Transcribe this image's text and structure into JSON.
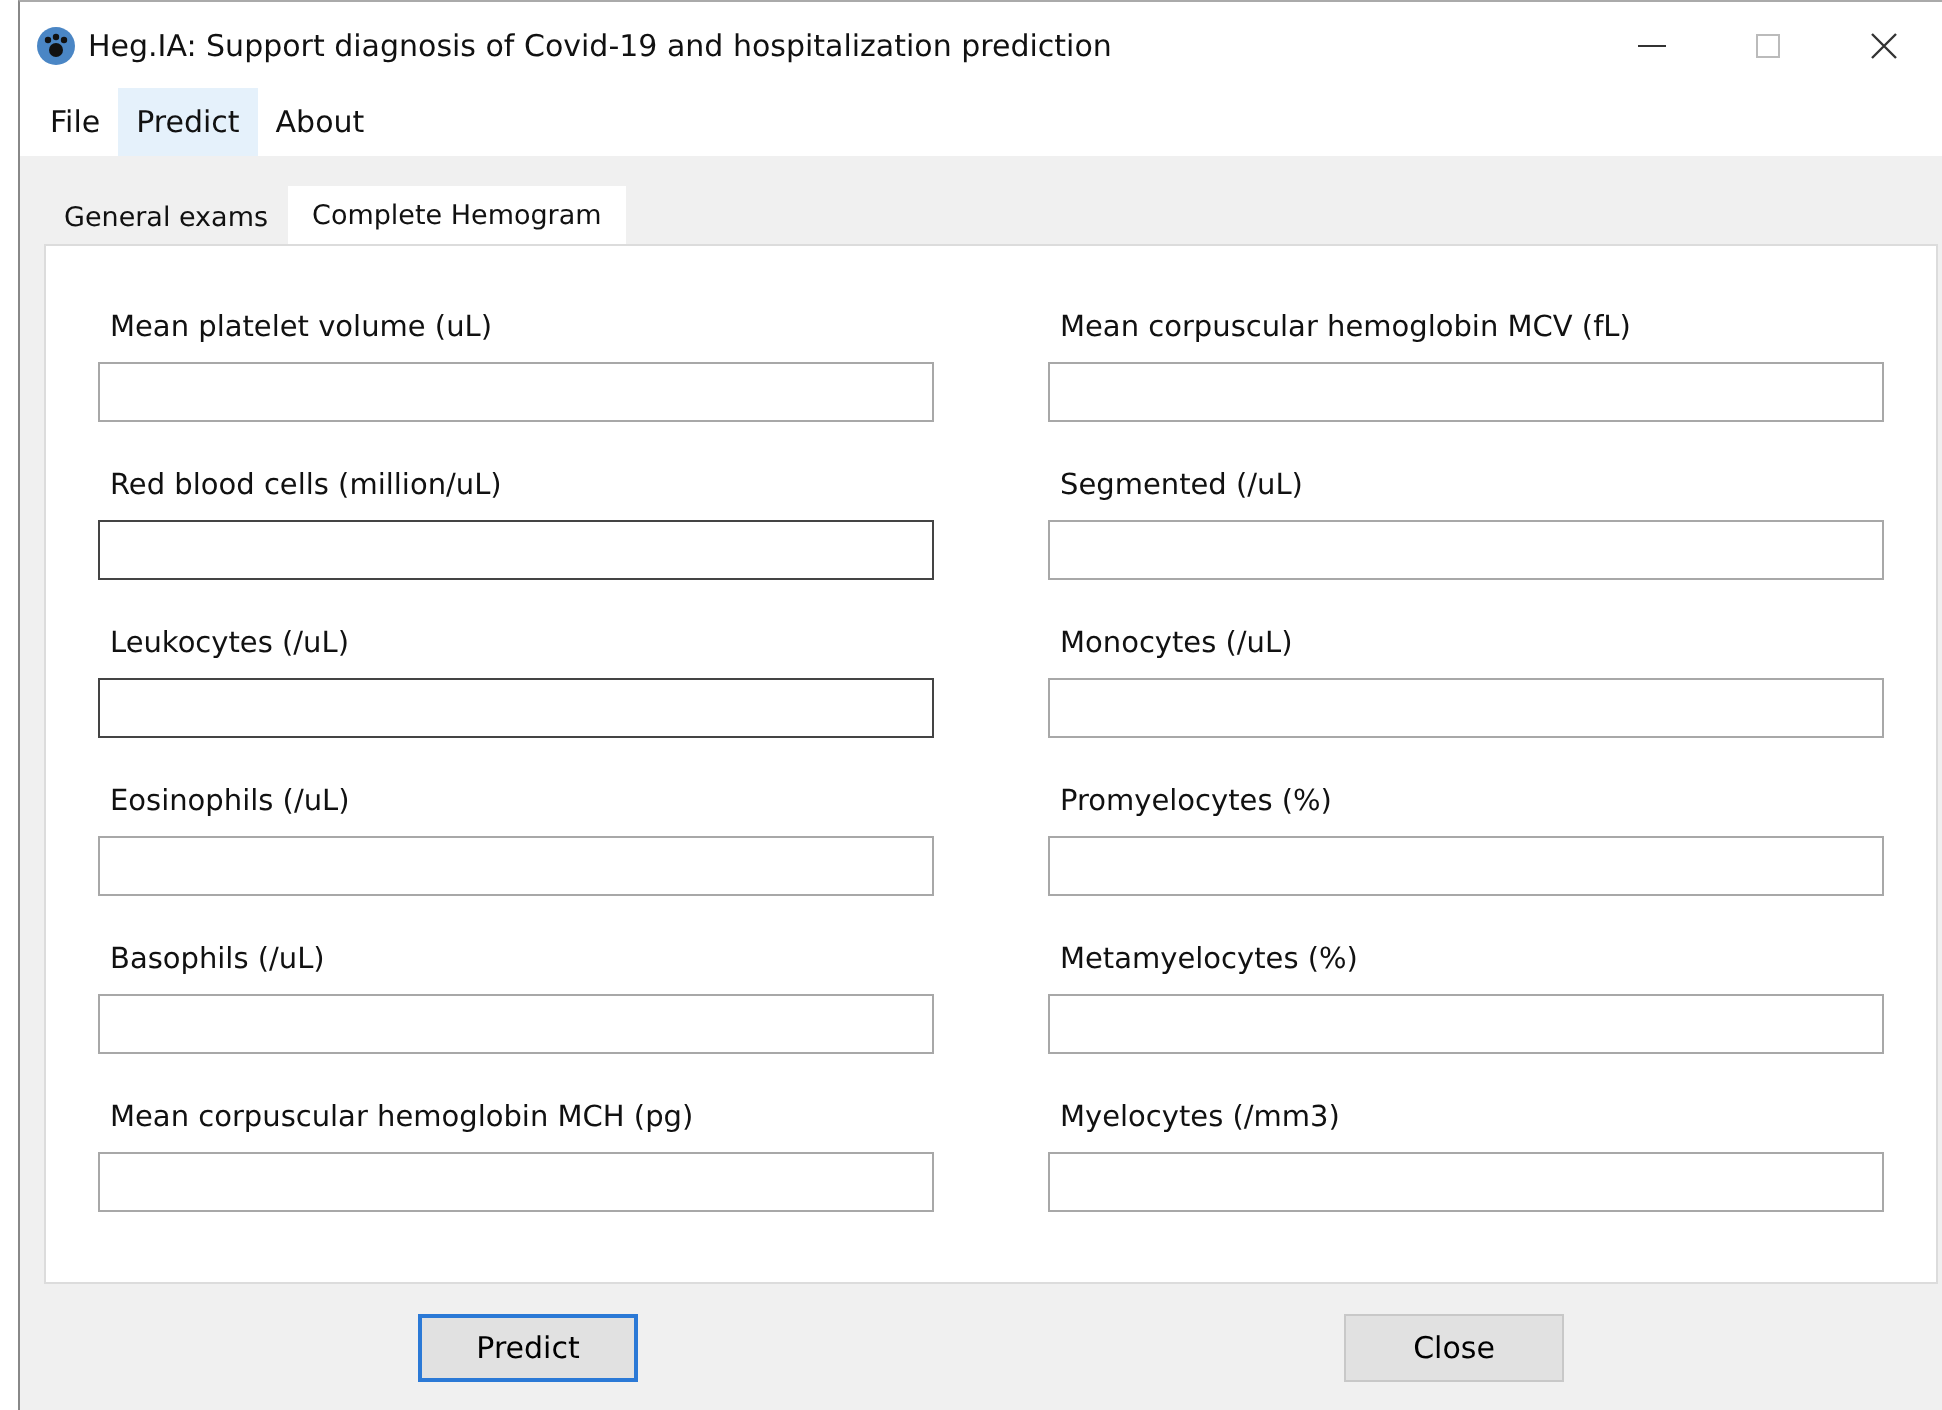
{
  "window": {
    "title": "Heg.IA:  Support diagnosis of Covid-19 and hospitalization prediction"
  },
  "menu": [
    {
      "label": "File",
      "selected": false
    },
    {
      "label": "Predict",
      "selected": true
    },
    {
      "label": "About",
      "selected": false
    }
  ],
  "tabs": [
    {
      "label": "General exams",
      "selected": false
    },
    {
      "label": "Complete Hemogram",
      "selected": true
    }
  ],
  "fields": [
    {
      "label": "Mean platelet volume (uL)",
      "highlighted": false
    },
    {
      "label": "Mean corpuscular hemoglobin MCV (fL)",
      "highlighted": false
    },
    {
      "label": "Red blood cells (million/uL)",
      "highlighted": true
    },
    {
      "label": "Segmented (/uL)",
      "highlighted": false
    },
    {
      "label": "Leukocytes (/uL)",
      "highlighted": true
    },
    {
      "label": "Monocytes (/uL)",
      "highlighted": false
    },
    {
      "label": "Eosinophils (/uL)",
      "highlighted": false
    },
    {
      "label": "Promyelocytes (%)",
      "highlighted": false
    },
    {
      "label": "Basophils (/uL)",
      "highlighted": false
    },
    {
      "label": "Metamyelocytes (%)",
      "highlighted": false
    },
    {
      "label": "Mean corpuscular hemoglobin MCH (pg)",
      "highlighted": false
    },
    {
      "label": "Myelocytes (/mm3)",
      "highlighted": false
    }
  ],
  "buttons": [
    {
      "label": "Predict",
      "default": true
    },
    {
      "label": "Close",
      "default": false
    }
  ]
}
